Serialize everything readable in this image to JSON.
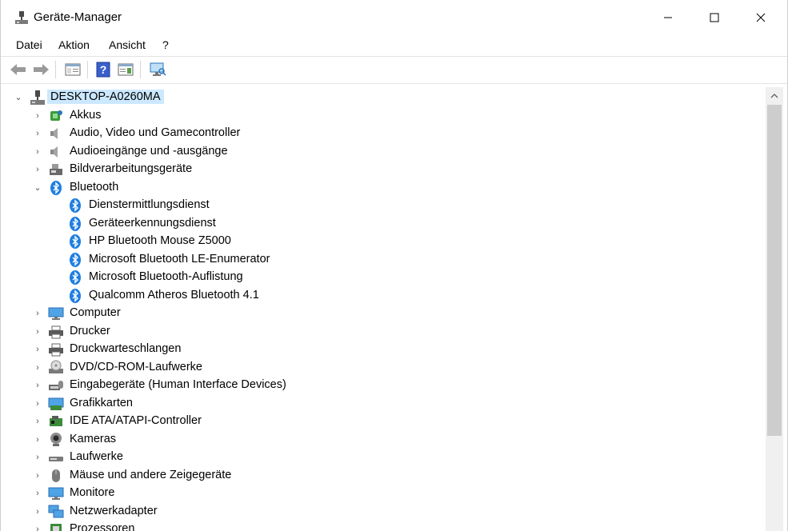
{
  "window": {
    "title": "Geräte-Manager",
    "controls": {
      "minimize": "minimize",
      "maximize": "maximize",
      "close": "close"
    }
  },
  "menu": [
    "Datei",
    "Aktion",
    "Ansicht",
    "?"
  ],
  "toolbar": {
    "buttons": [
      "back-icon",
      "forward-icon",
      "properties-icon",
      "help-icon",
      "device-list-icon",
      "scan-hardware-icon"
    ]
  },
  "tree": {
    "root": "DESKTOP-A0260MA",
    "categories": [
      {
        "label": "Akkus",
        "icon": "battery-icon"
      },
      {
        "label": "Audio, Video und Gamecontroller",
        "icon": "speaker-icon"
      },
      {
        "label": "Audioeingänge und -ausgänge",
        "icon": "speaker-icon"
      },
      {
        "label": "Bildverarbeitungsgeräte",
        "icon": "camera-device-icon"
      },
      {
        "label": "Bluetooth",
        "icon": "bluetooth-icon",
        "expanded": true,
        "children": [
          "Dienstermittlungsdienst",
          "Geräteerkennungsdienst",
          "HP Bluetooth Mouse Z5000",
          "Microsoft Bluetooth LE-Enumerator",
          "Microsoft Bluetooth-Auflistung",
          "Qualcomm Atheros Bluetooth 4.1"
        ]
      },
      {
        "label": "Computer",
        "icon": "monitor-icon"
      },
      {
        "label": "Drucker",
        "icon": "printer-icon"
      },
      {
        "label": "Druckwarteschlangen",
        "icon": "printer-icon"
      },
      {
        "label": "DVD/CD-ROM-Laufwerke",
        "icon": "disc-drive-icon"
      },
      {
        "label": "Eingabegeräte (Human Interface Devices)",
        "icon": "hid-icon"
      },
      {
        "label": "Grafikkarten",
        "icon": "display-adapter-icon"
      },
      {
        "label": "IDE ATA/ATAPI-Controller",
        "icon": "controller-icon"
      },
      {
        "label": "Kameras",
        "icon": "webcam-icon"
      },
      {
        "label": "Laufwerke",
        "icon": "drive-icon"
      },
      {
        "label": "Mäuse und andere Zeigegeräte",
        "icon": "mouse-icon"
      },
      {
        "label": "Monitore",
        "icon": "monitor-icon"
      },
      {
        "label": "Netzwerkadapter",
        "icon": "network-icon"
      },
      {
        "label": "Prozessoren",
        "icon": "processor-icon"
      }
    ]
  },
  "colors": {
    "selection": "#cce8ff",
    "bluetooth": "#1e7fe0",
    "scroll_thumb": "#cdcdcd"
  }
}
